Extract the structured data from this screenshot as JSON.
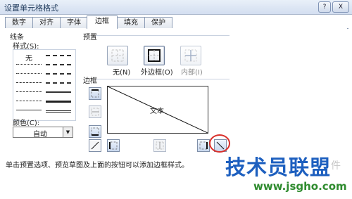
{
  "window": {
    "title": "设置单元格格式",
    "help_btn": "?",
    "close_btn": "X"
  },
  "tabs": [
    "数字",
    "对齐",
    "字体",
    "边框",
    "填充",
    "保护"
  ],
  "active_tab": 3,
  "line": {
    "group_label": "线条",
    "style_label": "样式(S):",
    "none_label": "无",
    "color_label": "颜色(C):",
    "color_value": "自动"
  },
  "presets": {
    "group_label": "预置",
    "none": "无(N)",
    "outline": "外边框(O)",
    "inside": "内部(I)"
  },
  "border": {
    "group_label": "边框",
    "preview_text": "文本"
  },
  "hint": "单击预置选项、预览草图及上面的按钮可以添加边框样式。",
  "watermark": {
    "main": "技术员联盟",
    "url": "www.jsgho.com",
    "extra": "件"
  },
  "colors": {
    "accent_red": "#d9302b",
    "brand_blue": "#1d5fbf",
    "brand_green": "#2e8b2e"
  }
}
